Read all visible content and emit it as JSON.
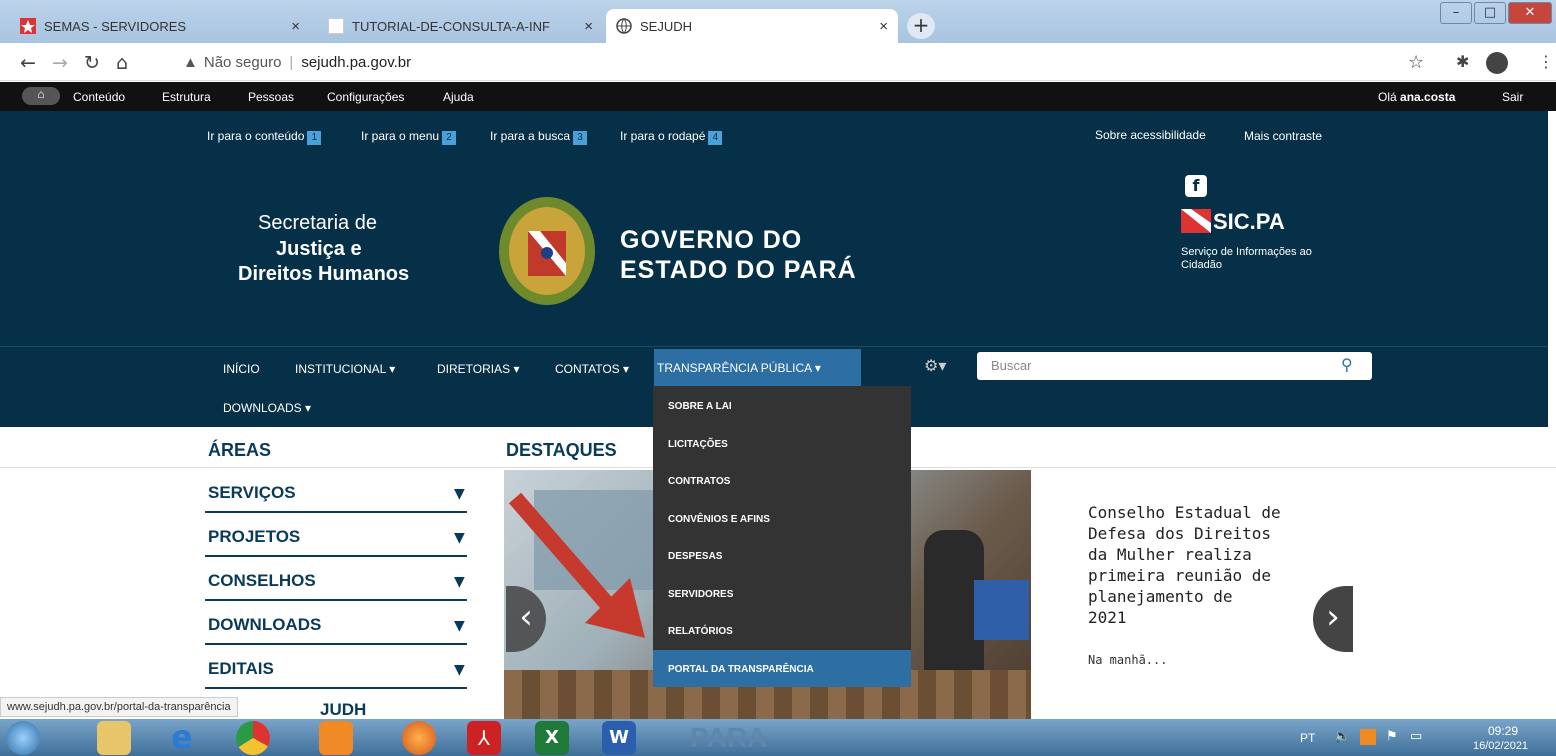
{
  "browser": {
    "tabs": [
      {
        "title": "SEMAS - SERVIDORES",
        "close": "×"
      },
      {
        "title": "TUTORIAL-DE-CONSULTA-A-INF",
        "close": "×"
      },
      {
        "title": "SEJUDH",
        "close": "×"
      }
    ],
    "new_tab": "+",
    "window_controls": [
      "–",
      "□",
      "✕"
    ],
    "security_label": "Não seguro",
    "url": "sejudh.pa.gov.br"
  },
  "admin_bar": {
    "items": [
      "Conteúdo",
      "Estrutura",
      "Pessoas",
      "Configurações",
      "Ajuda"
    ],
    "greeting": "Olá",
    "user": "ana.costa",
    "logout": "Sair"
  },
  "skip_links": [
    {
      "label": "Ir para o conteúdo",
      "key": "1"
    },
    {
      "label": "Ir para o menu",
      "key": "2"
    },
    {
      "label": "Ir para a busca",
      "key": "3"
    },
    {
      "label": "Ir para o rodapé",
      "key": "4"
    }
  ],
  "accessibility": {
    "about": "Sobre acessibilidade",
    "contrast": "Mais contraste"
  },
  "brand": {
    "secretaria_1": "Secretaria de",
    "secretaria_2": "Justiça e",
    "secretaria_3": "Direitos Humanos",
    "governo_1": "GOVERNO DO",
    "governo_2": "ESTADO DO PARÁ"
  },
  "sic": {
    "title": "SIC.PA",
    "subtitle_1": "Serviço de Informações ao",
    "subtitle_2": "Cidadão"
  },
  "main_menu": [
    "INÍCIO",
    "INSTITUCIONAL ▾",
    "DIRETORIAS ▾",
    "CONTATOS ▾",
    "TRANSPARÊNCIA PÚBLICA ▾",
    "DOWNLOADS ▾"
  ],
  "search": {
    "placeholder": "Buscar"
  },
  "dropdown": [
    "SOBRE A LAI",
    "LICITAÇÕES",
    "CONTRATOS",
    "CONVÊNIOS E AFINS",
    "DESPESAS",
    "SERVIDORES",
    "RELATÓRIOS",
    "PORTAL DA TRANSPARÊNCIA"
  ],
  "areas": {
    "heading": "ÁREAS",
    "items": [
      "SERVIÇOS",
      "PROJETOS",
      "CONSELHOS",
      "DOWNLOADS",
      "EDITAIS"
    ],
    "partial": "JUDH"
  },
  "destaques": {
    "heading": "DESTAQUES",
    "headline_1": "Conselho Estadual de",
    "headline_2": "Defesa dos Direitos",
    "headline_3": "da Mulher realiza",
    "headline_4": "primeira reunião de",
    "headline_5": "planejamento de",
    "headline_6": "2021",
    "excerpt": "Na manhã..."
  },
  "status_url": "www.sejudh.pa.gov.br/portal-da-transparência",
  "taskbar": {
    "lang": "PT",
    "time": "09:29",
    "date": "16/02/2021",
    "watermark": "PARA"
  },
  "colors": {
    "header": "#063047",
    "accent": "#2d6ea3",
    "dropdown": "#333333"
  }
}
